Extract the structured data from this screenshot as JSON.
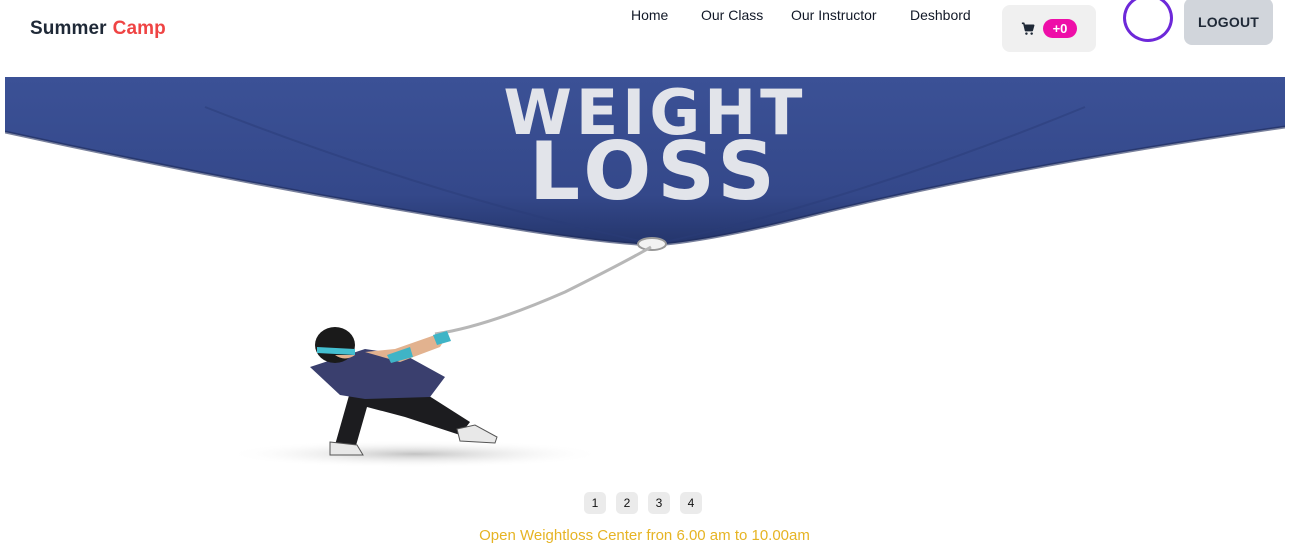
{
  "brand": {
    "first": "Summer",
    "second": "Camp"
  },
  "nav": {
    "links": [
      "Home",
      "Our Class",
      "Our Instructor",
      "Deshbord"
    ],
    "cart_count": "+0",
    "logout_label": "LOGOUT"
  },
  "hero": {
    "banner_line1": "WEIGHT",
    "banner_line2": "LOSS"
  },
  "carousel": {
    "buttons": [
      "1",
      "2",
      "3",
      "4"
    ]
  },
  "caption": "Open Weightloss Center fron 6.00 am to 10.00am",
  "colors": {
    "brand_accent": "#ef4444",
    "cart_badge": "#ee0ea8",
    "avatar_ring": "#6d28d9",
    "banner_blue": "#34488a",
    "caption": "#e6b424"
  }
}
